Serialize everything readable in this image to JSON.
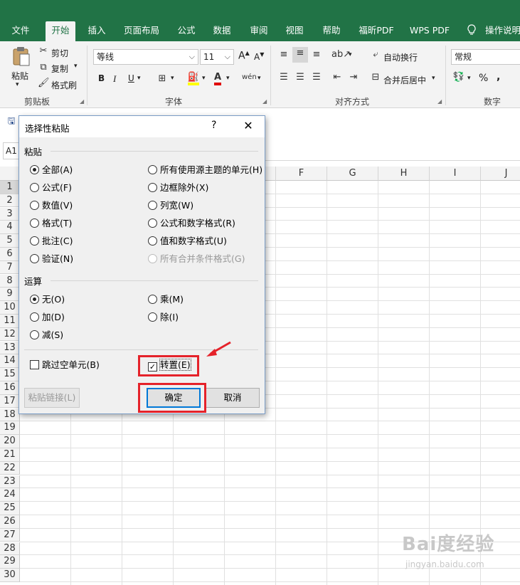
{
  "ribbon_tabs": [
    "文件",
    "开始",
    "插入",
    "页面布局",
    "公式",
    "数据",
    "审阅",
    "视图",
    "帮助",
    "福昕PDF",
    "WPS PDF",
    "操作说明"
  ],
  "ribbon": {
    "paste_label": "粘贴",
    "cut": "剪切",
    "copy": "复制",
    "format_painter": "格式刷",
    "clipboard_group": "剪贴板",
    "font_name": "等线",
    "font_size": "11",
    "font_group": "字体",
    "wrap_text": "自动换行",
    "merge_center": "合并后居中",
    "align_group": "对齐方式",
    "number_format": "常规",
    "number_group": "数字",
    "bold": "B",
    "italic": "I",
    "underline": "U",
    "font_grow": "A",
    "font_shrink": "A",
    "percent": "%",
    "comma": ","
  },
  "name_box": "A1",
  "column_headers": [
    "F",
    "G",
    "H",
    "I",
    "J"
  ],
  "row_headers": [
    "1",
    "2",
    "3",
    "4",
    "5",
    "6",
    "7",
    "8",
    "9",
    "10",
    "11",
    "12",
    "13",
    "14",
    "15",
    "16",
    "17",
    "18",
    "19",
    "20",
    "21",
    "22",
    "23",
    "24",
    "25",
    "26",
    "27",
    "28",
    "29",
    "30"
  ],
  "dialog": {
    "title": "选择性粘贴",
    "help": "?",
    "close": "✕",
    "paste_section": "粘贴",
    "paste_options_left": [
      "全部(A)",
      "公式(F)",
      "数值(V)",
      "格式(T)",
      "批注(C)",
      "验证(N)"
    ],
    "paste_options_right": [
      "所有使用源主题的单元(H)",
      "边框除外(X)",
      "列宽(W)",
      "公式和数字格式(R)",
      "值和数字格式(U)",
      "所有合并条件格式(G)"
    ],
    "operation_section": "运算",
    "operation_options_left": [
      "无(O)",
      "加(D)",
      "减(S)"
    ],
    "operation_options_right": [
      "乘(M)",
      "除(I)"
    ],
    "skip_blanks": "跳过空单元(B)",
    "transpose": "转置(E)",
    "paste_link": "粘贴链接(L)",
    "ok": "确定",
    "cancel": "取消"
  },
  "annotation_color": "#e5222a",
  "accent_color": "#217346"
}
